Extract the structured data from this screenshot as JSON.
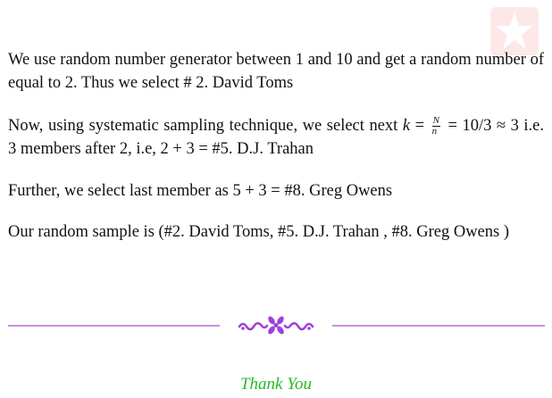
{
  "paragraphs": {
    "p1": "We use random number generator between 1 and 10 and get a random number of equal to 2. Thus we select # 2. David Toms",
    "p2_a": "Now, using systematic sampling technique, we select next",
    "p2_k": "k",
    "p2_eq": "=",
    "p2_num": "N",
    "p2_den": "n",
    "p2_b": "= 10/3 ≈ 3 i.e. 3 members after 2, i.e, 2 + 3 = #5. D.J. Trahan",
    "p3": "Further, we select last member as 5 + 3 = #8. Greg Owens",
    "p4": "Our random sample is (#2. David Toms, #5. D.J. Trahan , #8. Greg Owens )"
  },
  "footer": {
    "thanks": "Thank You"
  },
  "colors": {
    "rule": "#c890e0",
    "ornament": "#a040d8",
    "thanks": "#22bb22",
    "logo_bg": "#fde8e8"
  }
}
